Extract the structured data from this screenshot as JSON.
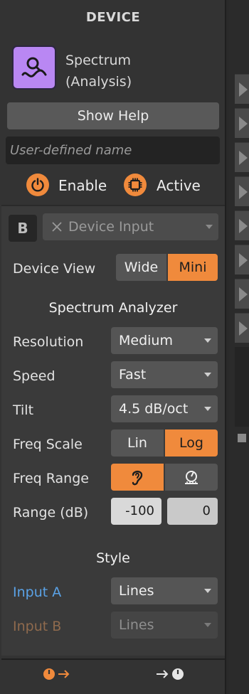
{
  "header": {
    "title": "DEVICE"
  },
  "device": {
    "name_line1": "Spectrum",
    "name_line2": "(Analysis)",
    "icon": "spectrum-analyzer-icon",
    "icon_color": "#b987f3"
  },
  "help_button": "Show Help",
  "name_field": {
    "placeholder": "User-defined name",
    "value": ""
  },
  "enable": {
    "label": "Enable",
    "icon": "power-icon"
  },
  "active": {
    "label": "Active",
    "icon": "chip-icon"
  },
  "input_section": {
    "badge": "B",
    "device_input": {
      "icon": "close-icon",
      "label": "Device Input"
    }
  },
  "device_view": {
    "label": "Device View",
    "options": [
      "Wide",
      "Mini"
    ],
    "selected": "Mini"
  },
  "analyzer": {
    "title": "Spectrum Analyzer",
    "resolution": {
      "label": "Resolution",
      "value": "Medium"
    },
    "speed": {
      "label": "Speed",
      "value": "Fast"
    },
    "tilt": {
      "label": "Tilt",
      "value": "4.5 dB/oct"
    },
    "freq_scale": {
      "label": "Freq Scale",
      "options": [
        "Lin",
        "Log"
      ],
      "selected": "Log"
    },
    "freq_range": {
      "label": "Freq Range",
      "options": [
        "ear-icon",
        "meter-icon"
      ],
      "selected": "ear-icon"
    },
    "range_db": {
      "label": "Range (dB)",
      "min": "-100",
      "max": "0"
    }
  },
  "style": {
    "title": "Style",
    "input_a": {
      "label": "Input A",
      "value": "Lines",
      "color": "#5aa2e6"
    },
    "input_b": {
      "label": "Input B",
      "value": "Lines",
      "color": "#8f6a4d"
    }
  },
  "footer": {
    "left_icon": "meter-out-icon",
    "right_icon": "meter-in-icon"
  },
  "colors": {
    "accent": "#f08a3c",
    "panel": "#333333"
  }
}
